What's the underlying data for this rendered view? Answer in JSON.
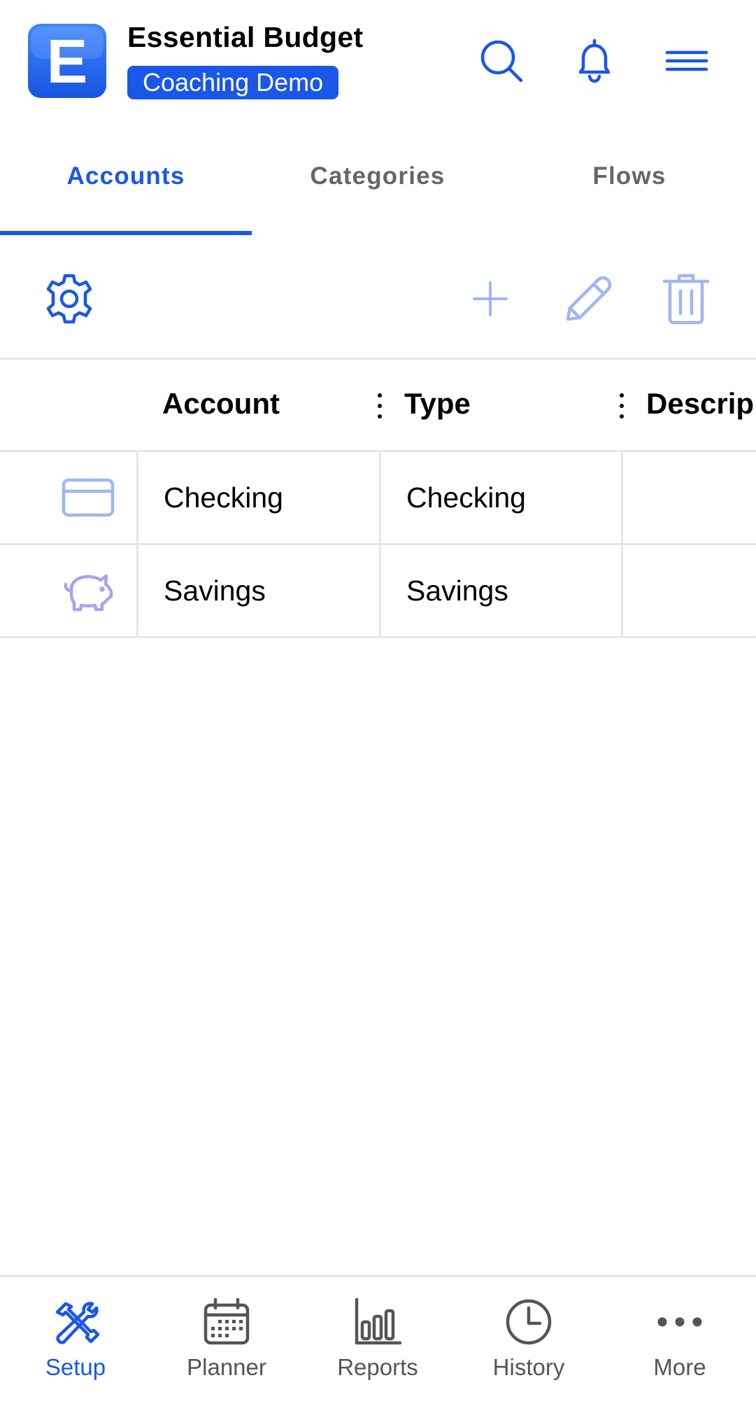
{
  "header": {
    "app_title": "Essential Budget",
    "badge": "Coaching Demo",
    "logo_letter": "E",
    "icons": [
      "search-icon",
      "bell-icon",
      "hamburger-menu-icon"
    ]
  },
  "tabs": [
    {
      "label": "Accounts",
      "active": true
    },
    {
      "label": "Categories",
      "active": false
    },
    {
      "label": "Flows",
      "active": false
    }
  ],
  "toolbar": {
    "icons": [
      "gear-icon",
      "plus-icon",
      "pencil-icon",
      "trash-icon"
    ]
  },
  "table": {
    "columns": [
      "Account",
      "Type",
      "Descrip"
    ],
    "rows": [
      {
        "icon": "credit-card-icon",
        "account": "Checking",
        "type": "Checking",
        "description": ""
      },
      {
        "icon": "piggy-bank-icon",
        "account": "Savings",
        "type": "Savings",
        "description": ""
      }
    ]
  },
  "bottom_nav": [
    {
      "label": "Setup",
      "icon": "tools-icon",
      "active": true
    },
    {
      "label": "Planner",
      "icon": "calendar-icon",
      "active": false
    },
    {
      "label": "Reports",
      "icon": "bar-chart-icon",
      "active": false
    },
    {
      "label": "History",
      "icon": "clock-icon",
      "active": false
    },
    {
      "label": "More",
      "icon": "more-dots-icon",
      "active": false
    }
  ],
  "colors": {
    "accent": "#1a56e8",
    "accent_light": "#9fb7f2",
    "piggy": "#a9a3ee",
    "border": "#e4e6ee",
    "inactive_text": "#555555"
  }
}
